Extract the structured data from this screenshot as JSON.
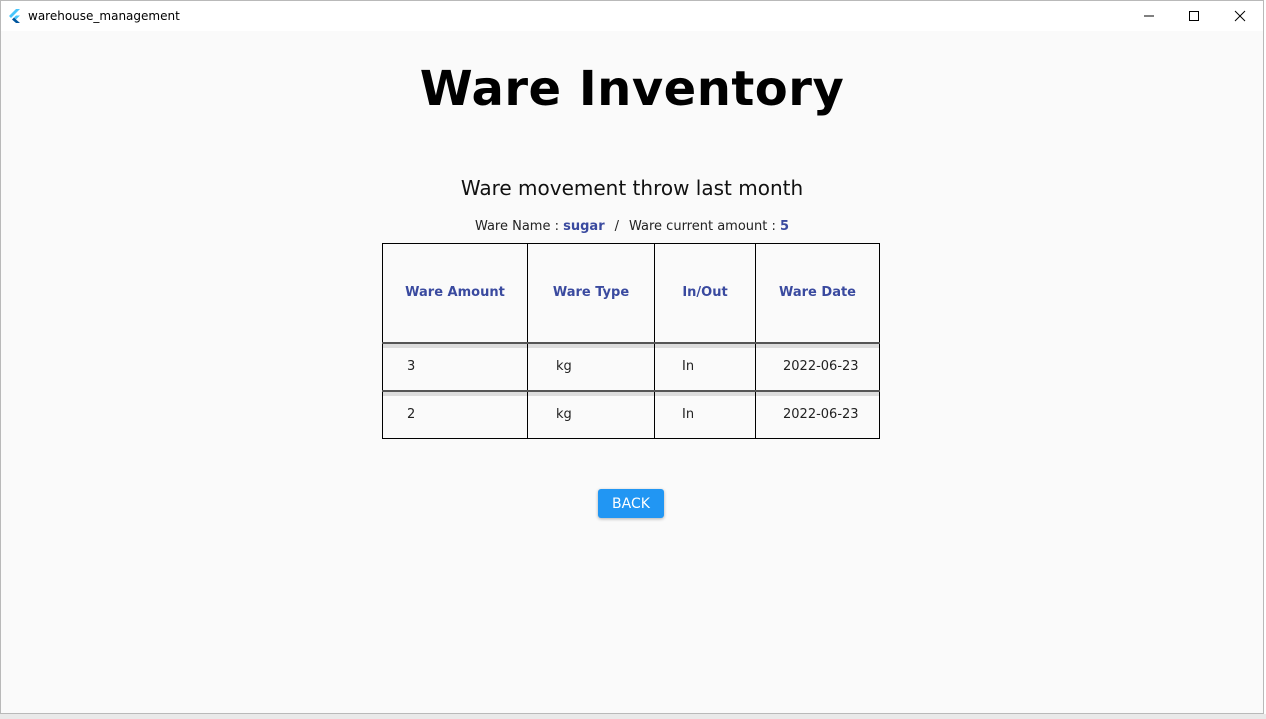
{
  "window": {
    "title": "warehouse_management",
    "minimize_icon": "minimize-icon",
    "maximize_icon": "maximize-icon",
    "close_icon": "close-icon"
  },
  "page": {
    "title": "Ware Inventory",
    "subtitle": "Ware movement throw last month",
    "info": {
      "name_label": "Ware Name : ",
      "name_value": "sugar",
      "separator": "/",
      "amount_label": "Ware current amount : ",
      "amount_value": "5"
    }
  },
  "table": {
    "headers": [
      "Ware Amount",
      "Ware Type",
      "In/Out",
      "Ware Date"
    ],
    "rows": [
      [
        "3",
        "kg",
        "In",
        "2022-06-23"
      ],
      [
        "2",
        "kg",
        "In",
        "2022-06-23"
      ]
    ]
  },
  "actions": {
    "back_label": "BACK"
  },
  "colors": {
    "accent": "#2196f3",
    "header_text": "#3a4a9f",
    "background": "#fafafa"
  }
}
